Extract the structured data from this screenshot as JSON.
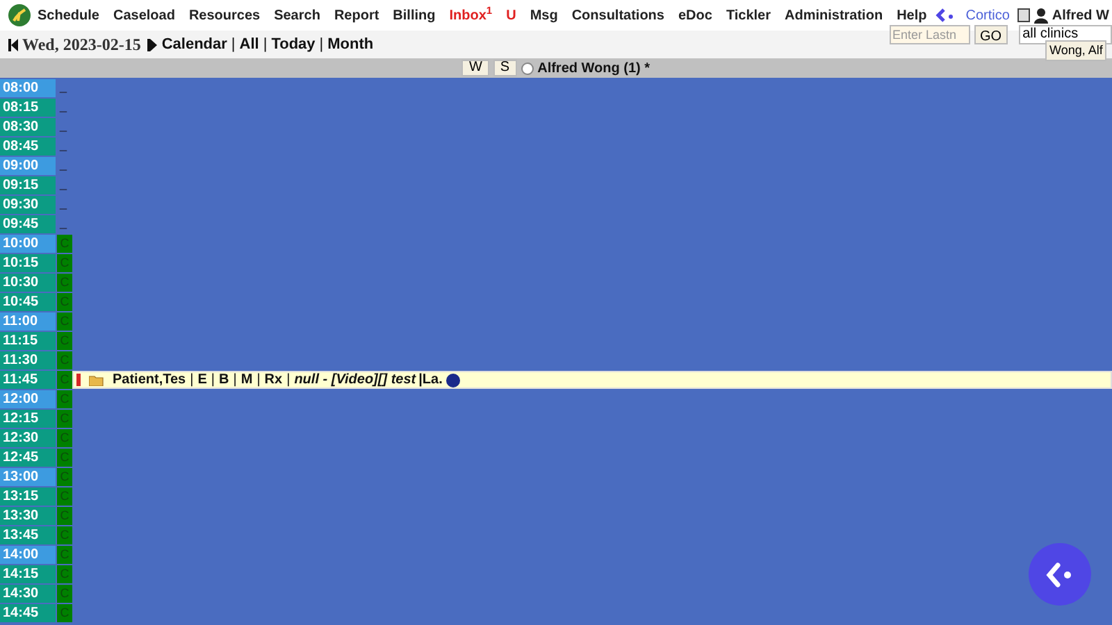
{
  "menu": [
    {
      "label": "Schedule",
      "alert": false
    },
    {
      "label": "Caseload",
      "alert": false
    },
    {
      "label": "Resources",
      "alert": false
    },
    {
      "label": "Search",
      "alert": false
    },
    {
      "label": "Report",
      "alert": false
    },
    {
      "label": "Billing",
      "alert": false
    },
    {
      "label": "Inbox$^{1}$",
      "alert": true
    },
    {
      "label": "U",
      "alert": true
    },
    {
      "label": "Msg",
      "alert": false
    },
    {
      "label": "Consultations",
      "alert": false
    },
    {
      "label": "eDoc",
      "alert": false
    },
    {
      "label": "Tickler",
      "alert": false
    },
    {
      "label": "Administration",
      "alert": false
    },
    {
      "label": "Help",
      "alert": false
    }
  ],
  "brand": {
    "label": "Cortico"
  },
  "user": {
    "name": "Alfred W"
  },
  "date_nav": {
    "date": "Wed, 2023-02-15",
    "parts": [
      {
        "text": "Calendar",
        "kind": "link"
      },
      {
        "text": "|",
        "kind": "sep"
      },
      {
        "text": "All",
        "kind": "link"
      },
      {
        "text": "|",
        "kind": "sep"
      },
      {
        "text": "Today",
        "kind": "link"
      },
      {
        "text": "|",
        "kind": "sep"
      },
      {
        "text": "Month",
        "kind": "link"
      }
    ]
  },
  "search": {
    "placeholder": "Enter Lastn",
    "button": "GO",
    "clinic": "all clinics",
    "provider": "Wong, Alf"
  },
  "provider_bar": {
    "buttons": [
      "W",
      "S"
    ],
    "radio_selected": false,
    "name": "Alfred Wong (1) *"
  },
  "slots": [
    {
      "time": "08:00",
      "hour": true,
      "code": "_",
      "kind": "blank"
    },
    {
      "time": "08:15",
      "hour": false,
      "code": "_",
      "kind": "blank"
    },
    {
      "time": "08:30",
      "hour": false,
      "code": "_",
      "kind": "blank"
    },
    {
      "time": "08:45",
      "hour": false,
      "code": "_",
      "kind": "blank"
    },
    {
      "time": "09:00",
      "hour": true,
      "code": "_",
      "kind": "blank"
    },
    {
      "time": "09:15",
      "hour": false,
      "code": "_",
      "kind": "blank"
    },
    {
      "time": "09:30",
      "hour": false,
      "code": "_",
      "kind": "blank"
    },
    {
      "time": "09:45",
      "hour": false,
      "code": "_",
      "kind": "blank"
    },
    {
      "time": "10:00",
      "hour": true,
      "code": "C",
      "kind": "code"
    },
    {
      "time": "10:15",
      "hour": false,
      "code": "C",
      "kind": "code"
    },
    {
      "time": "10:30",
      "hour": false,
      "code": "C",
      "kind": "code"
    },
    {
      "time": "10:45",
      "hour": false,
      "code": "C",
      "kind": "code"
    },
    {
      "time": "11:00",
      "hour": true,
      "code": "C",
      "kind": "code"
    },
    {
      "time": "11:15",
      "hour": false,
      "code": "C",
      "kind": "code"
    },
    {
      "time": "11:30",
      "hour": false,
      "code": "C",
      "kind": "code"
    },
    {
      "time": "11:45",
      "hour": false,
      "code": "C",
      "kind": "code",
      "appointment": {
        "color": "#d62828",
        "parts": [
          {
            "text": "Patient,Tes",
            "kind": "name"
          },
          {
            "text": "|",
            "kind": "sep"
          },
          {
            "text": "E",
            "kind": "link"
          },
          {
            "text": "|",
            "kind": "sep"
          },
          {
            "text": "B",
            "kind": "link"
          },
          {
            "text": "|",
            "kind": "sep"
          },
          {
            "text": "M",
            "kind": "link"
          },
          {
            "text": "|",
            "kind": "sep"
          },
          {
            "text": "Rx",
            "kind": "link"
          },
          {
            "text": "|",
            "kind": "sep"
          },
          {
            "text": "null - [Video][] test",
            "kind": "note"
          },
          {
            "text": "|La.",
            "kind": "text"
          }
        ]
      }
    },
    {
      "time": "12:00",
      "hour": true,
      "code": "C",
      "kind": "code"
    },
    {
      "time": "12:15",
      "hour": false,
      "code": "C",
      "kind": "code"
    },
    {
      "time": "12:30",
      "hour": false,
      "code": "C",
      "kind": "code"
    },
    {
      "time": "12:45",
      "hour": false,
      "code": "C",
      "kind": "code"
    },
    {
      "time": "13:00",
      "hour": true,
      "code": "C",
      "kind": "code"
    },
    {
      "time": "13:15",
      "hour": false,
      "code": "C",
      "kind": "code"
    },
    {
      "time": "13:30",
      "hour": false,
      "code": "C",
      "kind": "code"
    },
    {
      "time": "13:45",
      "hour": false,
      "code": "C",
      "kind": "code"
    },
    {
      "time": "14:00",
      "hour": true,
      "code": "C",
      "kind": "code"
    },
    {
      "time": "14:15",
      "hour": false,
      "code": "C",
      "kind": "code"
    },
    {
      "time": "14:30",
      "hour": false,
      "code": "C",
      "kind": "code"
    },
    {
      "time": "14:45",
      "hour": false,
      "code": "C",
      "kind": "code"
    }
  ]
}
